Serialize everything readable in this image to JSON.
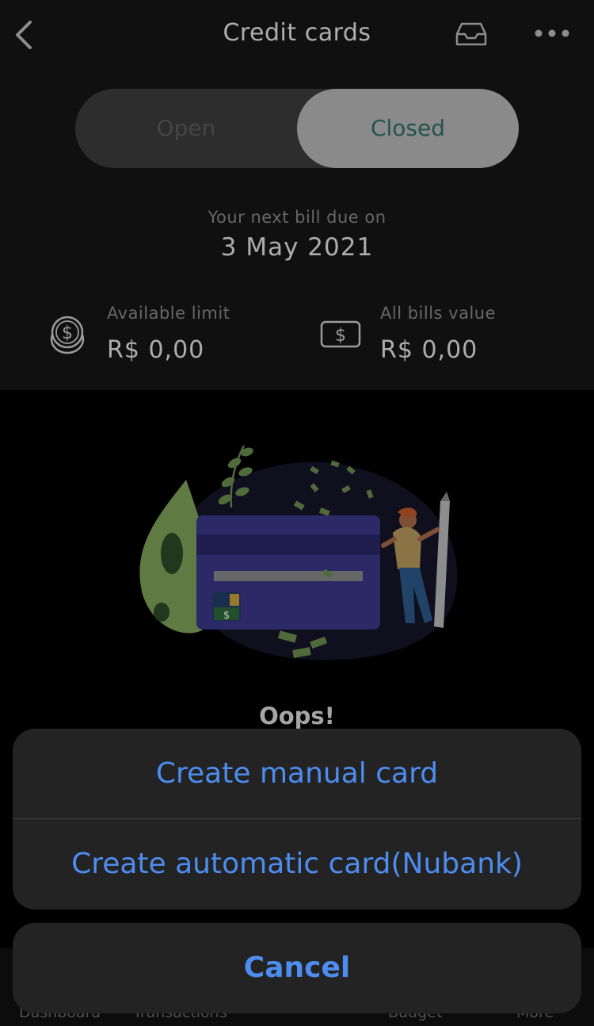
{
  "header": {
    "title": "Credit cards"
  },
  "toggle": {
    "open_label": "Open",
    "closed_label": "Closed",
    "selected": "Closed"
  },
  "bill": {
    "due_label": "Your next bill due on",
    "due_date": "3 May 2021"
  },
  "stats": {
    "available_limit_label": "Available limit",
    "available_limit_value": "R$ 0,00",
    "all_bills_label": "All bills value",
    "all_bills_value": "R$ 0,00"
  },
  "empty_state": {
    "title": "Oops!"
  },
  "bottom_nav": {
    "items": [
      "Dashboard",
      "Transactions",
      "Budget",
      "More"
    ]
  },
  "action_sheet": {
    "options": [
      "Create manual card",
      "Create automatic card(Nubank)"
    ],
    "cancel_label": "Cancel"
  },
  "colors": {
    "accent_blue": "#4d8df0",
    "closed_text": "#2f7061",
    "card_purple": "#3a3789"
  }
}
